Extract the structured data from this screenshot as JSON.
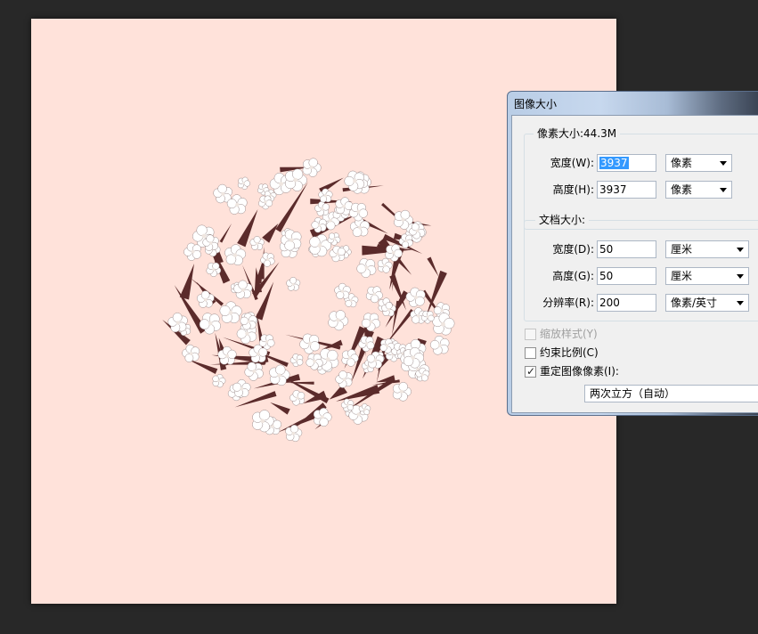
{
  "dialog": {
    "title": "图像大小",
    "pixel_dimensions": {
      "title": "像素大小:44.3M",
      "width": {
        "label": "宽度(W):",
        "value": "3937",
        "unit": "像素"
      },
      "height": {
        "label": "高度(H):",
        "value": "3937",
        "unit": "像素"
      }
    },
    "document_size": {
      "title": "文档大小:",
      "width": {
        "label": "宽度(D):",
        "value": "50",
        "unit": "厘米"
      },
      "height": {
        "label": "高度(G):",
        "value": "50",
        "unit": "厘米"
      },
      "resolution": {
        "label": "分辨率(R):",
        "value": "200",
        "unit": "像素/英寸"
      }
    },
    "options": {
      "scale_styles": {
        "label": "缩放样式(Y)",
        "checked": false,
        "enabled": false
      },
      "constrain_proportions": {
        "label": "约束比例(C)",
        "checked": false,
        "enabled": true
      },
      "resample_image": {
        "label": "重定图像像素(I):",
        "checked": true,
        "enabled": true
      },
      "resample_method": "两次立方（自动）"
    }
  },
  "colors": {
    "workspace": "#282828",
    "canvas": "#ffe2da",
    "branch": "#5b2b2b",
    "blossom": "#ffffff"
  }
}
